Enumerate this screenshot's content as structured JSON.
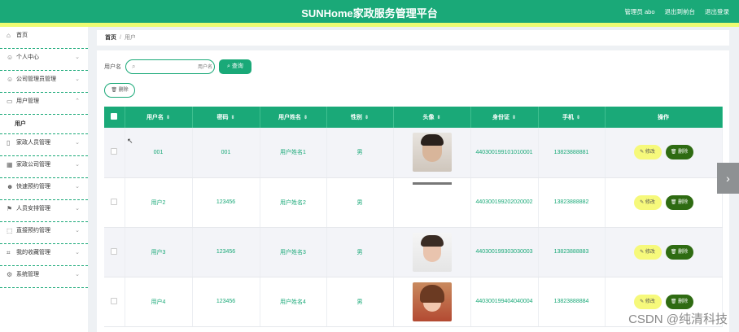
{
  "header": {
    "title": "SUNHome家政服务管理平台",
    "admin": "管理员 abo",
    "back_to_front": "退出到前台",
    "logout": "退出登录"
  },
  "sidebar": {
    "items": [
      {
        "icon": "home-icon",
        "label": "首页"
      },
      {
        "icon": "user-icon",
        "label": "个人中心"
      },
      {
        "icon": "user-icon",
        "label": "公司管理员管理"
      },
      {
        "icon": "monitor-icon",
        "label": "用户管理"
      },
      {
        "icon": "phone-icon",
        "label": "家政人员管理"
      },
      {
        "icon": "grid-icon",
        "label": "家政公司管理"
      },
      {
        "icon": "users-icon",
        "label": "快速预约管理"
      },
      {
        "icon": "flag-icon",
        "label": "人员安排管理"
      },
      {
        "icon": "frame-icon",
        "label": "直接预约管理"
      },
      {
        "icon": "crop-icon",
        "label": "我的收藏管理"
      },
      {
        "icon": "gear-icon",
        "label": "系统管理"
      }
    ],
    "sub_item": "用户"
  },
  "breadcrumb": {
    "home": "首页",
    "sep": "/",
    "current": "用户"
  },
  "search": {
    "label": "用户名",
    "placeholder": "用户名",
    "button": "查询"
  },
  "delete_button": "删除",
  "table": {
    "headers": [
      "用户名",
      "密码",
      "用户姓名",
      "性别",
      "头像",
      "身份证",
      "手机",
      "操作"
    ],
    "rows": [
      {
        "username": "001",
        "password": "001",
        "name": "用户姓名1",
        "gender": "男",
        "idcard": "440300199101010001",
        "phone": "13823888881"
      },
      {
        "username": "用户2",
        "password": "123456",
        "name": "用户姓名2",
        "gender": "男",
        "idcard": "440300199202020002",
        "phone": "13823888882"
      },
      {
        "username": "用户3",
        "password": "123456",
        "name": "用户姓名3",
        "gender": "男",
        "idcard": "440300199303030003",
        "phone": "13823888883"
      },
      {
        "username": "用户4",
        "password": "123456",
        "name": "用户姓名4",
        "gender": "男",
        "idcard": "440300199404040004",
        "phone": "13823888884"
      }
    ],
    "edit_label": "修改",
    "delete_label": "删除"
  },
  "watermark": "CSDN @纯清科技",
  "colors": {
    "primary": "#1aa978",
    "accent_yellow": "#eefc72",
    "danger_green": "#2e6b12"
  }
}
